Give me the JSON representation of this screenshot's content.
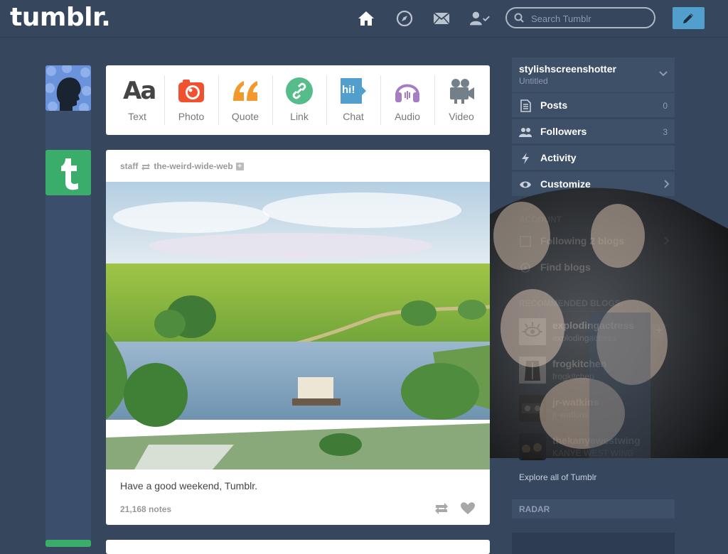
{
  "header": {
    "logo": "tumblr.",
    "search_placeholder": "Search Tumblr",
    "nav_icons": [
      "home-icon",
      "compass-icon",
      "mail-icon",
      "account-icon"
    ],
    "compose_icon": "pencil-icon"
  },
  "post_types": [
    {
      "label": "Text",
      "color": "#444444",
      "icon": "text-icon"
    },
    {
      "label": "Photo",
      "color": "#f0512f",
      "icon": "camera-icon"
    },
    {
      "label": "Quote",
      "color": "#f2992e",
      "icon": "quote-icon"
    },
    {
      "label": "Link",
      "color": "#56bc8a",
      "icon": "link-icon"
    },
    {
      "label": "Chat",
      "color": "#529ecc",
      "icon": "chat-icon"
    },
    {
      "label": "Audio",
      "color": "#a77dc2",
      "icon": "headphones-icon"
    },
    {
      "label": "Video",
      "color": "#748089",
      "icon": "video-camera-icon"
    }
  ],
  "type_text_glyph": "Aa",
  "chat_glyph": "hi!",
  "post": {
    "author": "staff",
    "reblogged_from": "the-weird-wide-web",
    "caption": "Have a good weekend, Tumblr.",
    "notes": "21,168 notes"
  },
  "sidebar": {
    "blog_name": "stylishscreenshotter",
    "blog_sub": "Untitled",
    "rows": [
      {
        "label": "Posts",
        "count": "0",
        "icon": "posts-icon"
      },
      {
        "label": "Followers",
        "count": "3",
        "icon": "followers-icon"
      },
      {
        "label": "Activity",
        "count": "",
        "icon": "lightning-icon"
      },
      {
        "label": "Customize",
        "count": "",
        "icon": "eye-icon"
      }
    ],
    "account_heading": "ACCOUNT",
    "account_rows": [
      {
        "label": "Following 2 blogs",
        "icon": "following-icon"
      },
      {
        "label": "Find blogs",
        "icon": "find-blogs-icon"
      }
    ],
    "recommended_heading": "RECOMMENDED BLOGS",
    "recommended": [
      {
        "name": "explodingactress",
        "sub": "explodingactress"
      },
      {
        "name": "frogkitchen",
        "sub": "frogkitchen"
      },
      {
        "name": "jr-watkins",
        "sub": "jr-watkins"
      },
      {
        "name": "thekanyewestwing",
        "sub": "KANYE WEST WING"
      }
    ],
    "explore": "Explore all of Tumblr",
    "radar": "RADAR"
  },
  "colors": {
    "background": "#36465d",
    "accent": "#529ecc",
    "sidebar_row": "#3e4f68"
  }
}
